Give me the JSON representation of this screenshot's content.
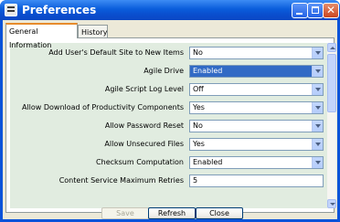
{
  "window": {
    "title": "Preferences"
  },
  "tabs": [
    {
      "label": "General Information"
    },
    {
      "label": "History"
    }
  ],
  "rows": [
    {
      "label": "Add User's Default Site to New Items",
      "value": "No"
    },
    {
      "label": "Agile Drive",
      "value": "Enabled"
    },
    {
      "label": "Agile Script Log Level",
      "value": "Off"
    },
    {
      "label": "Allow Download of Productivity Components",
      "value": "Yes"
    },
    {
      "label": "Allow Password Reset",
      "value": "No"
    },
    {
      "label": "Allow Unsecured Files",
      "value": "Yes"
    },
    {
      "label": "Checksum Computation",
      "value": "Enabled"
    },
    {
      "label": "Content Service Maximum Retries",
      "value": "5"
    }
  ],
  "buttons": {
    "save": "Save",
    "refresh": "Refresh",
    "close": "Close"
  },
  "titlebar_buttons": {
    "close": "✕"
  },
  "colors": {
    "title_bar": "#0a5ddb",
    "selected_highlight": "#316ac5",
    "content_background": "#e1ece0"
  }
}
